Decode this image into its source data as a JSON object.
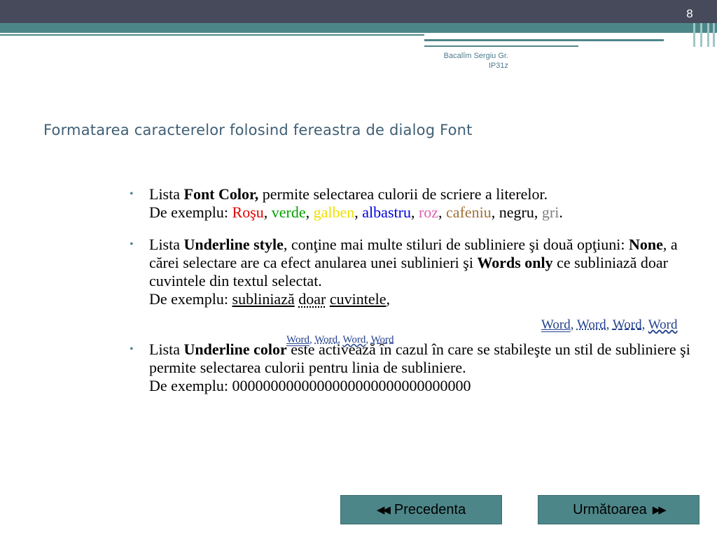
{
  "slide_number": "8",
  "author": {
    "line1": "Bacalîm Sergiu Gr.",
    "line2": "IP31z"
  },
  "title": "Formatarea caracterelor folosind fereastra de dialog Font",
  "bullets": {
    "b1": {
      "prefix": "Lista ",
      "bold": "Font Color,",
      "rest": " permite selectarea culorii de scriere a literelor.",
      "example_label": "De exemplu: ",
      "colors": [
        {
          "text": "Roşu",
          "color": "#e00000"
        },
        {
          "text": "verde",
          "color": "#00a000"
        },
        {
          "text": "galben",
          "color": "#f0e000"
        },
        {
          "text": "albastru",
          "color": "#0000e0"
        },
        {
          "text": "roz",
          "color": "#e060b0"
        },
        {
          "text": "cafeniu",
          "color": "#a0703a"
        },
        {
          "text": "negru",
          "color": "#000000"
        },
        {
          "text": "gri",
          "color": "#808080"
        }
      ],
      "sep": ", ",
      "end": "."
    },
    "b2": {
      "prefix": "Lista ",
      "bold1": "Underline style",
      "mid1": ", conţine mai multe stiluri de subliniere şi două opţiuni: ",
      "bold2": "None",
      "mid2": ", a cărei selectare are ca efect anularea unei sublinieri şi ",
      "bold3": "Words only",
      "mid3": " ce subliniază doar cuvintele din textul selectat.",
      "example_label": "De exemplu: ",
      "ex1": "subliniază",
      "ex2": "doar",
      "ex3": "cuvintele",
      "ex_end": ","
    },
    "b3": {
      "prefix": "Lista ",
      "bold": "Underline color",
      "rest": " este activează în cazul în care se stabileşte un stil de subliniere şi permite selectarea culorii pentru linia de subliniere.",
      "example_label": " De exemplu: ",
      "example_value": "0000000000000000000000000000000"
    }
  },
  "word_images": {
    "word": "Word",
    "sep": ", "
  },
  "nav": {
    "prev_label": "Precedenta",
    "next_label": "Următoarea"
  }
}
